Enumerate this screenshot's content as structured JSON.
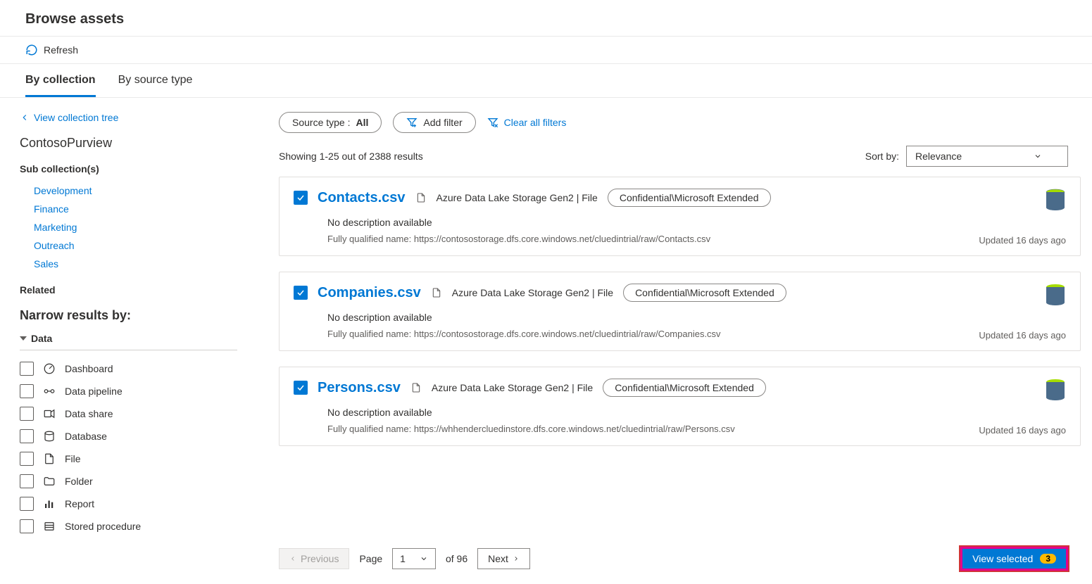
{
  "title": "Browse assets",
  "toolbar": {
    "refresh": "Refresh"
  },
  "tabs": {
    "by_collection": "By collection",
    "by_source_type": "By source type"
  },
  "sidebar": {
    "view_tree": "View collection tree",
    "collection": "ContosoPurview",
    "sub_head": "Sub collection(s)",
    "subs": [
      "Development",
      "Finance",
      "Marketing",
      "Outreach",
      "Sales"
    ],
    "related_head": "Related",
    "narrow_head": "Narrow results by:",
    "facet_group": "Data",
    "facets": [
      "Dashboard",
      "Data pipeline",
      "Data share",
      "Database",
      "File",
      "Folder",
      "Report",
      "Stored procedure"
    ]
  },
  "filters": {
    "source_label": "Source type : ",
    "source_value": "All",
    "add_filter": "Add filter",
    "clear": "Clear all filters"
  },
  "results_header": {
    "showing": "Showing 1-25 out of 2388 results",
    "sort_label": "Sort by:",
    "sort_value": "Relevance"
  },
  "results": [
    {
      "name": "Contacts.csv",
      "path": "Azure Data Lake Storage Gen2 | File",
      "classification": "Confidential\\Microsoft Extended",
      "desc": "No description available",
      "fqn": "Fully qualified name: https://contosostorage.dfs.core.windows.net/cluedintrial/raw/Contacts.csv",
      "updated": "Updated 16 days ago"
    },
    {
      "name": "Companies.csv",
      "path": "Azure Data Lake Storage Gen2 | File",
      "classification": "Confidential\\Microsoft Extended",
      "desc": "No description available",
      "fqn": "Fully qualified name: https://contosostorage.dfs.core.windows.net/cluedintrial/raw/Companies.csv",
      "updated": "Updated 16 days ago"
    },
    {
      "name": "Persons.csv",
      "path": "Azure Data Lake Storage Gen2 | File",
      "classification": "Confidential\\Microsoft Extended",
      "desc": "No description available",
      "fqn": "Fully qualified name: https://whhendercluedinstore.dfs.core.windows.net/cluedintrial/raw/Persons.csv",
      "updated": "Updated 16 days ago"
    }
  ],
  "pager": {
    "previous": "Previous",
    "page_label": "Page",
    "page_value": "1",
    "page_total": "of 96",
    "next": "Next",
    "view_selected": "View selected",
    "selected_count": "3"
  }
}
